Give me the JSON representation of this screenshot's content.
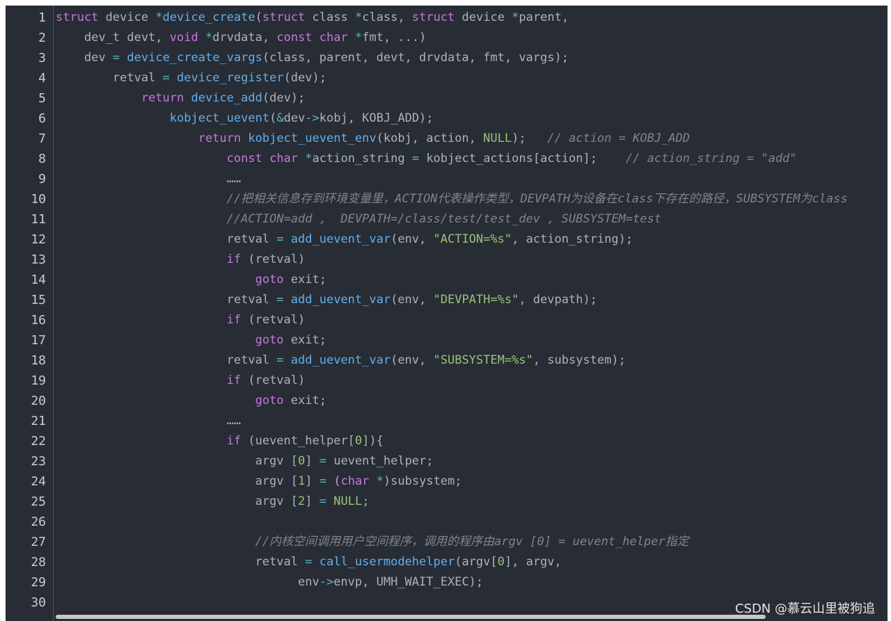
{
  "colors": {
    "background": "#282c34",
    "keyword": "#c678dd",
    "function": "#61afef",
    "string": "#98c379",
    "comment": "#7f848e",
    "number": "#98c379",
    "operator": "#56b6c2",
    "plain": "#abb2bf",
    "line_number": "#c8ccd4"
  },
  "watermark": "CSDN @慕云山里被狗追",
  "lines": [
    {
      "n": "1",
      "t": [
        [
          "k",
          "struct"
        ],
        [
          "p",
          " device "
        ],
        [
          "o",
          "*"
        ],
        [
          "f",
          "device_create"
        ],
        [
          "p",
          "("
        ],
        [
          "k",
          "struct"
        ],
        [
          "p",
          " class "
        ],
        [
          "o",
          "*"
        ],
        [
          "p",
          "class, "
        ],
        [
          "k",
          "struct"
        ],
        [
          "p",
          " device "
        ],
        [
          "o",
          "*"
        ],
        [
          "p",
          "parent,"
        ]
      ]
    },
    {
      "n": "2",
      "t": [
        [
          "p",
          "    dev_t devt, "
        ],
        [
          "k",
          "void"
        ],
        [
          "p",
          " "
        ],
        [
          "o",
          "*"
        ],
        [
          "p",
          "drvdata, "
        ],
        [
          "k",
          "const"
        ],
        [
          "p",
          " "
        ],
        [
          "k",
          "char"
        ],
        [
          "p",
          " "
        ],
        [
          "o",
          "*"
        ],
        [
          "p",
          "fmt, ...)"
        ]
      ]
    },
    {
      "n": "3",
      "t": [
        [
          "p",
          "    dev "
        ],
        [
          "o",
          "="
        ],
        [
          "p",
          " "
        ],
        [
          "f",
          "device_create_vargs"
        ],
        [
          "p",
          "(class, parent, devt, drvdata, fmt, vargs);"
        ]
      ]
    },
    {
      "n": "4",
      "t": [
        [
          "p",
          "        retval "
        ],
        [
          "o",
          "="
        ],
        [
          "p",
          " "
        ],
        [
          "f",
          "device_register"
        ],
        [
          "p",
          "(dev);"
        ]
      ]
    },
    {
      "n": "5",
      "t": [
        [
          "p",
          "            "
        ],
        [
          "k",
          "return"
        ],
        [
          "p",
          " "
        ],
        [
          "f",
          "device_add"
        ],
        [
          "p",
          "(dev);"
        ]
      ]
    },
    {
      "n": "6",
      "t": [
        [
          "p",
          "                "
        ],
        [
          "f",
          "kobject_uevent"
        ],
        [
          "p",
          "("
        ],
        [
          "o",
          "&"
        ],
        [
          "p",
          "dev"
        ],
        [
          "o",
          "->"
        ],
        [
          "p",
          "kobj, KOBJ_ADD);"
        ]
      ]
    },
    {
      "n": "7",
      "t": [
        [
          "p",
          "                    "
        ],
        [
          "k",
          "return"
        ],
        [
          "p",
          " "
        ],
        [
          "f",
          "kobject_uevent_env"
        ],
        [
          "p",
          "(kobj, action, "
        ],
        [
          "n",
          "NULL"
        ],
        [
          "p",
          ");   "
        ],
        [
          "c",
          "// action = KOBJ_ADD"
        ]
      ]
    },
    {
      "n": "8",
      "t": [
        [
          "p",
          "                        "
        ],
        [
          "k",
          "const"
        ],
        [
          "p",
          " "
        ],
        [
          "k",
          "char"
        ],
        [
          "p",
          " "
        ],
        [
          "o",
          "*"
        ],
        [
          "p",
          "action_string "
        ],
        [
          "o",
          "="
        ],
        [
          "p",
          " kobject_actions[action];    "
        ],
        [
          "c",
          "// action_string = \"add\""
        ]
      ]
    },
    {
      "n": "9",
      "t": [
        [
          "p",
          "                        ……"
        ]
      ]
    },
    {
      "n": "10",
      "t": [
        [
          "p",
          "                        "
        ],
        [
          "c",
          "//把相关信息存到环境变量里，ACTION代表操作类型，DEVPATH为设备在class下存在的路径，SUBSYSTEM为class"
        ]
      ]
    },
    {
      "n": "11",
      "t": [
        [
          "p",
          "                        "
        ],
        [
          "c",
          "//ACTION=add ,  DEVPATH=/class/test/test_dev , SUBSYSTEM=test"
        ]
      ]
    },
    {
      "n": "12",
      "t": [
        [
          "p",
          "                        retval "
        ],
        [
          "o",
          "="
        ],
        [
          "p",
          " "
        ],
        [
          "f",
          "add_uevent_var"
        ],
        [
          "p",
          "(env, "
        ],
        [
          "s",
          "\"ACTION=%s\""
        ],
        [
          "p",
          ", action_string);"
        ]
      ]
    },
    {
      "n": "13",
      "t": [
        [
          "p",
          "                        "
        ],
        [
          "k",
          "if"
        ],
        [
          "p",
          " (retval)"
        ]
      ]
    },
    {
      "n": "14",
      "t": [
        [
          "p",
          "                            "
        ],
        [
          "k",
          "goto"
        ],
        [
          "p",
          " exit;"
        ]
      ]
    },
    {
      "n": "15",
      "t": [
        [
          "p",
          "                        retval "
        ],
        [
          "o",
          "="
        ],
        [
          "p",
          " "
        ],
        [
          "f",
          "add_uevent_var"
        ],
        [
          "p",
          "(env, "
        ],
        [
          "s",
          "\"DEVPATH=%s\""
        ],
        [
          "p",
          ", devpath);"
        ]
      ]
    },
    {
      "n": "16",
      "t": [
        [
          "p",
          "                        "
        ],
        [
          "k",
          "if"
        ],
        [
          "p",
          " (retval)"
        ]
      ]
    },
    {
      "n": "17",
      "t": [
        [
          "p",
          "                            "
        ],
        [
          "k",
          "goto"
        ],
        [
          "p",
          " exit;"
        ]
      ]
    },
    {
      "n": "18",
      "t": [
        [
          "p",
          "                        retval "
        ],
        [
          "o",
          "="
        ],
        [
          "p",
          " "
        ],
        [
          "f",
          "add_uevent_var"
        ],
        [
          "p",
          "(env, "
        ],
        [
          "s",
          "\"SUBSYSTEM=%s\""
        ],
        [
          "p",
          ", subsystem);"
        ]
      ]
    },
    {
      "n": "19",
      "t": [
        [
          "p",
          "                        "
        ],
        [
          "k",
          "if"
        ],
        [
          "p",
          " (retval)"
        ]
      ]
    },
    {
      "n": "20",
      "t": [
        [
          "p",
          "                            "
        ],
        [
          "k",
          "goto"
        ],
        [
          "p",
          " exit;"
        ]
      ]
    },
    {
      "n": "21",
      "t": [
        [
          "p",
          "                        ……"
        ]
      ]
    },
    {
      "n": "22",
      "t": [
        [
          "p",
          "                        "
        ],
        [
          "k",
          "if"
        ],
        [
          "p",
          " (uevent_helper["
        ],
        [
          "n",
          "0"
        ],
        [
          "p",
          "]){"
        ]
      ]
    },
    {
      "n": "23",
      "t": [
        [
          "p",
          "                            argv ["
        ],
        [
          "n",
          "0"
        ],
        [
          "p",
          "] "
        ],
        [
          "o",
          "="
        ],
        [
          "p",
          " uevent_helper;"
        ]
      ]
    },
    {
      "n": "24",
      "t": [
        [
          "p",
          "                            argv ["
        ],
        [
          "n",
          "1"
        ],
        [
          "p",
          "] "
        ],
        [
          "o",
          "="
        ],
        [
          "p",
          " ("
        ],
        [
          "k",
          "char"
        ],
        [
          "p",
          " "
        ],
        [
          "o",
          "*"
        ],
        [
          "p",
          ")subsystem;"
        ]
      ]
    },
    {
      "n": "25",
      "t": [
        [
          "p",
          "                            argv ["
        ],
        [
          "n",
          "2"
        ],
        [
          "p",
          "] "
        ],
        [
          "o",
          "="
        ],
        [
          "p",
          " "
        ],
        [
          "n",
          "NULL"
        ],
        [
          "p",
          ";"
        ]
      ]
    },
    {
      "n": "26",
      "t": []
    },
    {
      "n": "27",
      "t": [
        [
          "p",
          "                            "
        ],
        [
          "c",
          "//内核空间调用用户空间程序，调用的程序由argv [0] = uevent_helper指定"
        ]
      ]
    },
    {
      "n": "28",
      "t": [
        [
          "p",
          "                            retval "
        ],
        [
          "o",
          "="
        ],
        [
          "p",
          " "
        ],
        [
          "f",
          "call_usermodehelper"
        ],
        [
          "p",
          "(argv["
        ],
        [
          "n",
          "0"
        ],
        [
          "p",
          "], argv,"
        ]
      ]
    },
    {
      "n": "29",
      "t": [
        [
          "p",
          "                                  env"
        ],
        [
          "o",
          "->"
        ],
        [
          "p",
          "envp, UMH_WAIT_EXEC);"
        ]
      ]
    },
    {
      "n": "30",
      "t": []
    }
  ]
}
